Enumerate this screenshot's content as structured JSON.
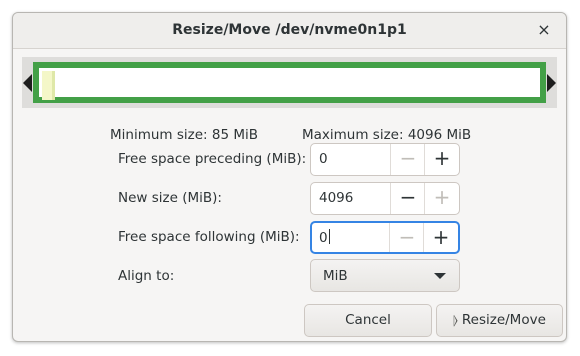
{
  "window": {
    "title": "Resize/Move /dev/nvme0n1p1",
    "close_glyph": "×"
  },
  "partition": {
    "used_fraction": 0.02,
    "border_color": "#43a047",
    "used_color": "#f4f7c8"
  },
  "info": {
    "minimum_label": "Minimum size: 85 MiB",
    "maximum_label": "Maximum size: 4096 MiB"
  },
  "fields": {
    "free_preceding": {
      "label": "Free space preceding (MiB):",
      "value": "0"
    },
    "new_size": {
      "label": "New size (MiB):",
      "value": "4096"
    },
    "free_following": {
      "label": "Free space following (MiB):",
      "value": "0"
    },
    "align": {
      "label": "Align to:",
      "value": "MiB"
    }
  },
  "glyphs": {
    "minus": "−",
    "plus": "+"
  },
  "buttons": {
    "cancel": "Cancel",
    "resize": "Resize/Move",
    "resize_icon": "resize-move-icon"
  },
  "colors": {
    "focus": "#3584e4"
  }
}
